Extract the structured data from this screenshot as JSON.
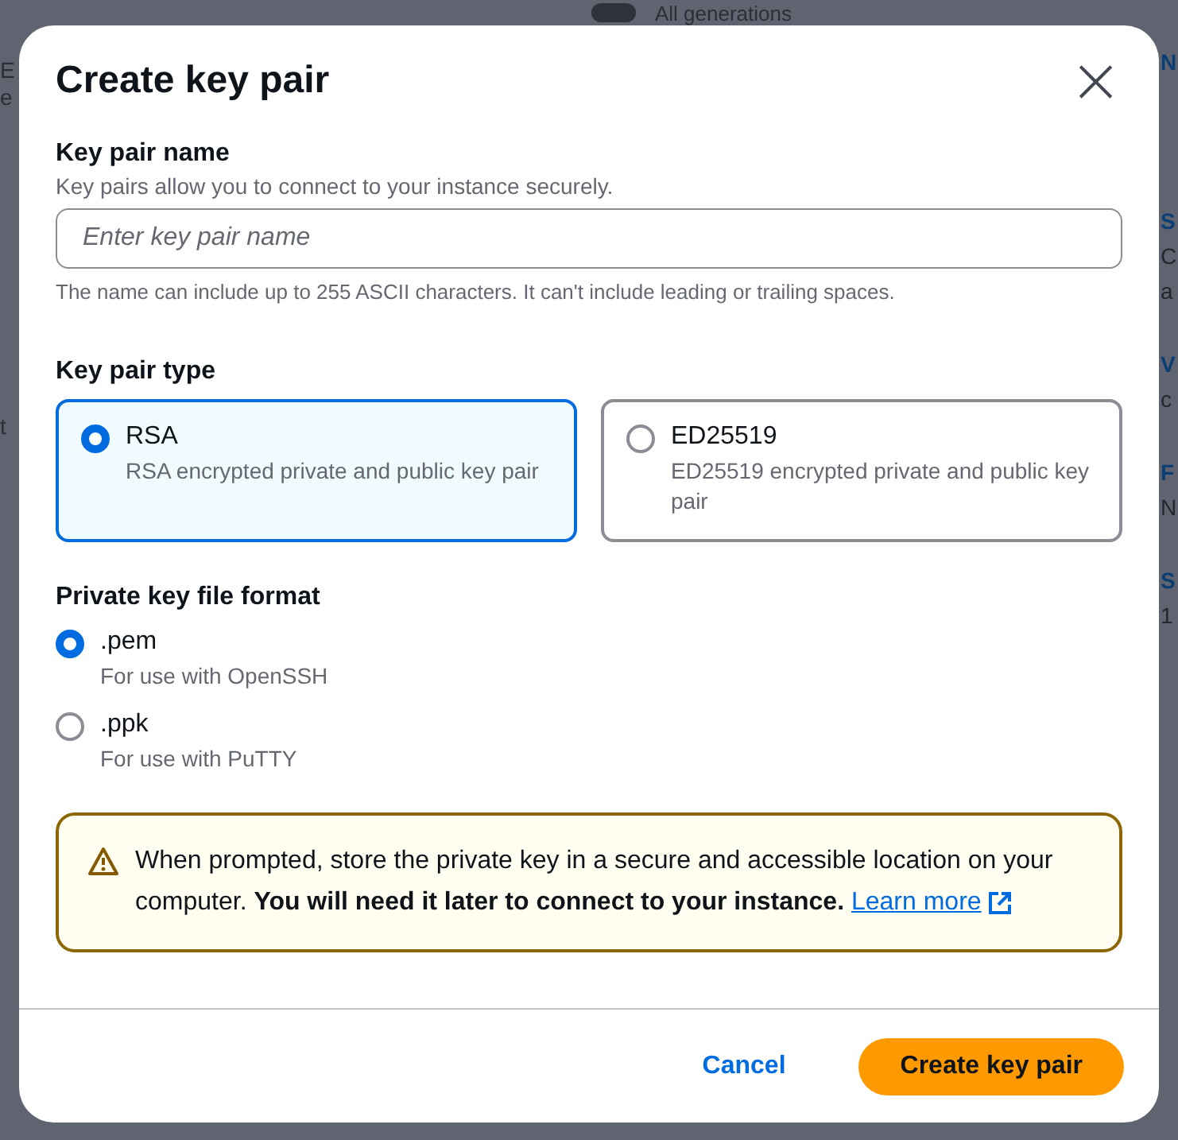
{
  "background": {
    "toggle_label": "All generations",
    "toggle_on": false,
    "left_fragments": [
      "E",
      "e",
      "t"
    ],
    "right_fragments": [
      {
        "kind": "heading",
        "text": "N"
      },
      {
        "kind": "heading",
        "text": "S"
      },
      {
        "kind": "value",
        "text": "C"
      },
      {
        "kind": "value",
        "text": "a"
      },
      {
        "kind": "heading",
        "text": "V"
      },
      {
        "kind": "value",
        "text": "c"
      },
      {
        "kind": "heading",
        "text": "F"
      },
      {
        "kind": "value",
        "text": "N"
      },
      {
        "kind": "heading",
        "text": "S"
      },
      {
        "kind": "value",
        "text": "1"
      }
    ]
  },
  "dialog": {
    "title": "Create key pair",
    "close": "×",
    "name_field": {
      "label": "Key pair name",
      "description": "Key pairs allow you to connect to your instance securely.",
      "placeholder": "Enter key pair name",
      "hint": "The name can include up to 255 ASCII characters. It can't include leading or trailing spaces."
    },
    "key_type": {
      "label": "Key pair type",
      "options": [
        {
          "title": "RSA",
          "description": "RSA encrypted private and public key pair",
          "selected": true
        },
        {
          "title": "ED25519",
          "description": "ED25519 encrypted private and public key pair",
          "selected": false
        }
      ]
    },
    "file_format": {
      "label": "Private key file format",
      "options": [
        {
          "title": ".pem",
          "description": "For use with OpenSSH",
          "selected": true
        },
        {
          "title": ".ppk",
          "description": "For use with PuTTY",
          "selected": false
        }
      ]
    },
    "warning": {
      "text": "When prompted, store the private key in a secure and accessible location on your computer. **You will need it later to connect to your instance.**",
      "link": "Learn more"
    },
    "buttons": {
      "cancel": "Cancel",
      "primary": "Create key pair"
    }
  }
}
